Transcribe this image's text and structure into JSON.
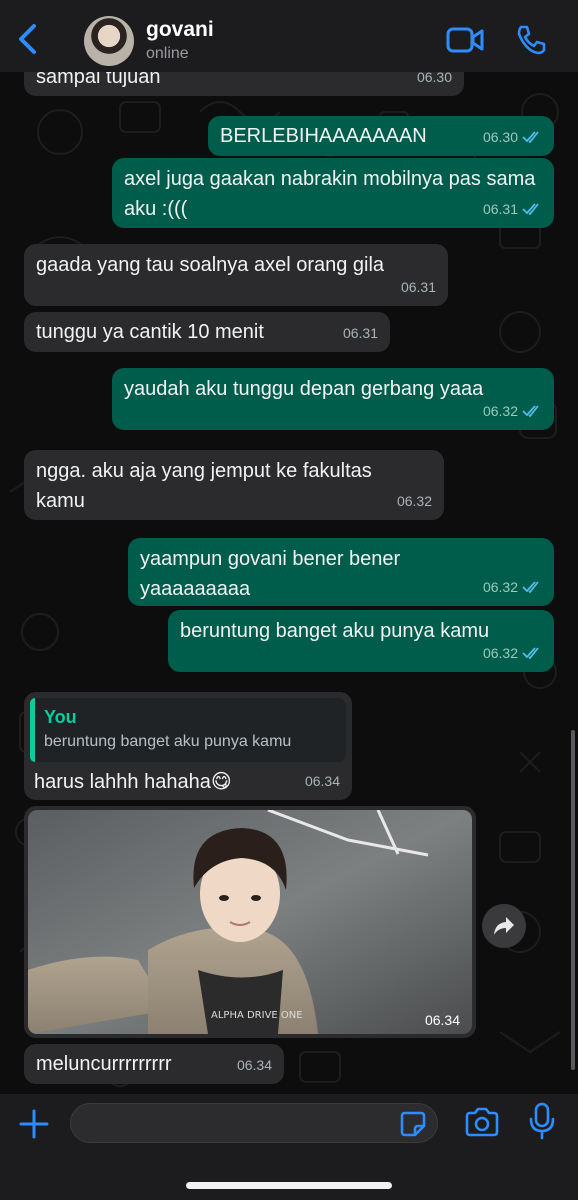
{
  "header": {
    "contact_name": "govani",
    "status": "online"
  },
  "icons": {
    "back": "chevron-left-icon",
    "video": "video-camera-icon",
    "call": "phone-icon",
    "plus": "plus-icon",
    "sticker": "sticker-icon",
    "camera": "camera-icon",
    "mic": "microphone-icon",
    "forward": "forward-arrow-icon"
  },
  "colors": {
    "accent": "#2f8cff",
    "incoming_bubble": "#2b2b2d",
    "outgoing_bubble": "#005c4b",
    "read_tick": "#53bdeb",
    "quote_accent": "#06cf9c"
  },
  "messages": [
    {
      "direction": "in",
      "text": "sampai tujuan",
      "time": "06.30"
    },
    {
      "direction": "out",
      "text": "BERLEBIHAAAAAAAN",
      "time": "06.30",
      "read": true
    },
    {
      "direction": "out",
      "text": "axel juga gaakan nabrakin mobilnya pas sama aku :(((",
      "time": "06.31",
      "read": true
    },
    {
      "direction": "in",
      "text": "gaada yang tau soalnya axel orang gila",
      "time": "06.31"
    },
    {
      "direction": "in",
      "text": "tunggu ya cantik 10 menit",
      "time": "06.31"
    },
    {
      "direction": "out",
      "text": "yaudah aku tunggu depan gerbang yaaa",
      "time": "06.32",
      "read": true
    },
    {
      "direction": "in",
      "text": "ngga. aku aja yang jemput ke fakultas kamu",
      "time": "06.32"
    },
    {
      "direction": "out",
      "text": "yaampun govani bener bener yaaaaaaaaa",
      "time": "06.32",
      "read": true
    },
    {
      "direction": "out",
      "text": "beruntung banget aku punya kamu",
      "time": "06.32",
      "read": true
    },
    {
      "direction": "in",
      "quote_author": "You",
      "quote_text": "beruntung banget aku punya kamu",
      "text": "harus lahhh hahaha😋",
      "time": "06.34"
    },
    {
      "direction": "in",
      "type": "photo",
      "time": "06.34",
      "photo_caption_text": "ALPHA DRIVE ONE"
    },
    {
      "direction": "in",
      "text": "meluncurrrrrrrrr",
      "time": "06.34"
    }
  ],
  "composer": {
    "placeholder": ""
  }
}
